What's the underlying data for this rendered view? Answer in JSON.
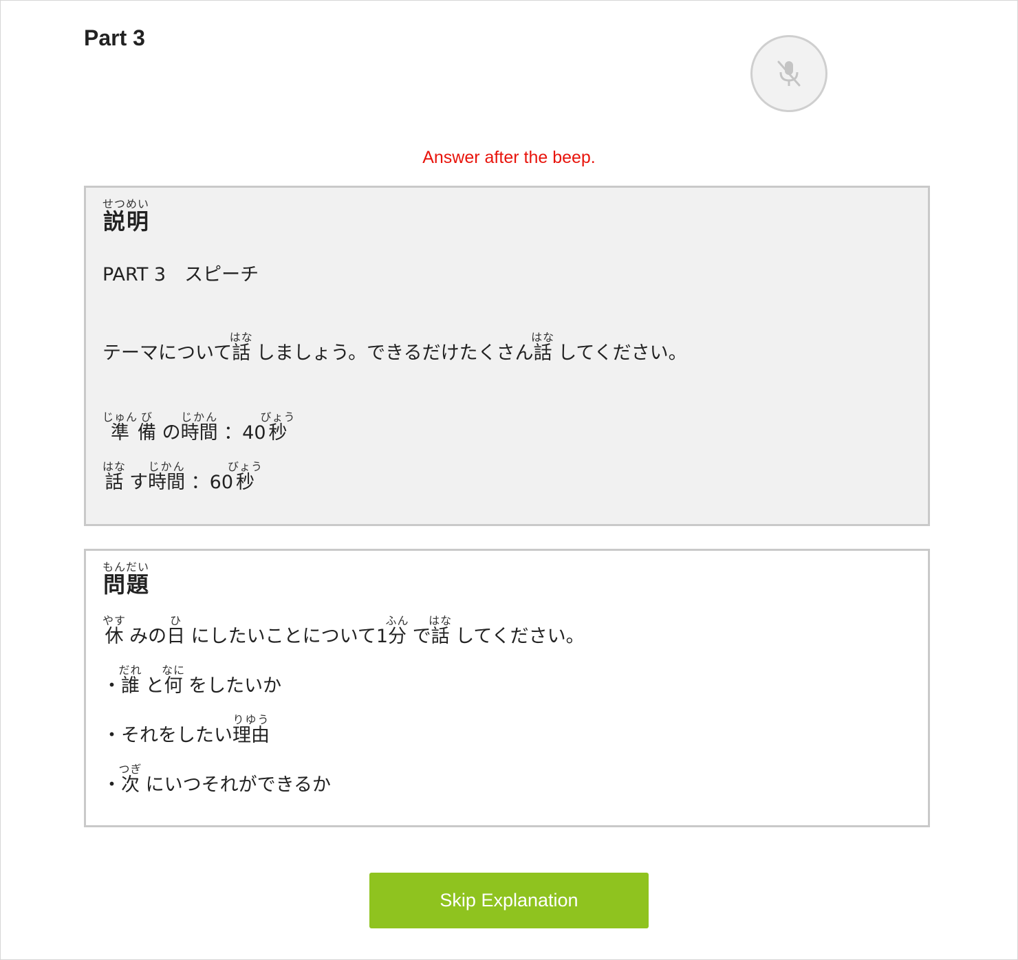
{
  "header": {
    "title": "Part 3"
  },
  "mic": {
    "icon": "mic-off-icon",
    "state": "muted"
  },
  "notice": {
    "text": "Answer after the beep."
  },
  "explanation": {
    "heading": {
      "base": "説明",
      "reading": "せつめい"
    },
    "part_label": "PART 3　スピーチ",
    "instruction": [
      {
        "text": "テーマについて"
      },
      {
        "base": "話",
        "reading": "はな"
      },
      {
        "text": " しましょう。できるだけたくさん"
      },
      {
        "base": "話",
        "reading": "はな"
      },
      {
        "text": " してください。"
      }
    ],
    "prep_time": [
      {
        "base": "準",
        "reading": "じゅん"
      },
      {
        "base": "備",
        "reading": "び"
      },
      {
        "text": " の"
      },
      {
        "base": "時間",
        "reading": "じかん"
      },
      {
        "text": " ：40"
      },
      {
        "base": "秒",
        "reading": "びょう"
      }
    ],
    "speak_time": [
      {
        "base": "話",
        "reading": "はな"
      },
      {
        "text": " す"
      },
      {
        "base": "時間",
        "reading": "じかん"
      },
      {
        "text": " ：60"
      },
      {
        "base": "秒",
        "reading": "びょう"
      }
    ]
  },
  "question": {
    "heading": {
      "base": "問題",
      "reading": "もんだい"
    },
    "prompt": [
      {
        "base": "休",
        "reading": "やす"
      },
      {
        "text": " みの"
      },
      {
        "base": "日",
        "reading": "ひ"
      },
      {
        "text": " にしたいことについて1"
      },
      {
        "base": "分",
        "reading": "ふん"
      },
      {
        "text": " で"
      },
      {
        "base": "話",
        "reading": "はな"
      },
      {
        "text": " してください。"
      }
    ],
    "bullets": [
      [
        {
          "text": "・"
        },
        {
          "base": "誰",
          "reading": "だれ"
        },
        {
          "text": " と"
        },
        {
          "base": "何",
          "reading": "なに"
        },
        {
          "text": " をしたいか"
        }
      ],
      [
        {
          "text": "・それをしたい"
        },
        {
          "base": "理由",
          "reading": "りゆう"
        }
      ],
      [
        {
          "text": "・"
        },
        {
          "base": "次",
          "reading": "つぎ"
        },
        {
          "text": " にいつそれができるか"
        }
      ]
    ]
  },
  "footer": {
    "skip_label": "Skip Explanation",
    "skip_color": "#8fc31f"
  },
  "colors": {
    "notice": "#e8140c",
    "panel_bg": "#f1f1f1",
    "panel_border": "#c9c9c9"
  }
}
